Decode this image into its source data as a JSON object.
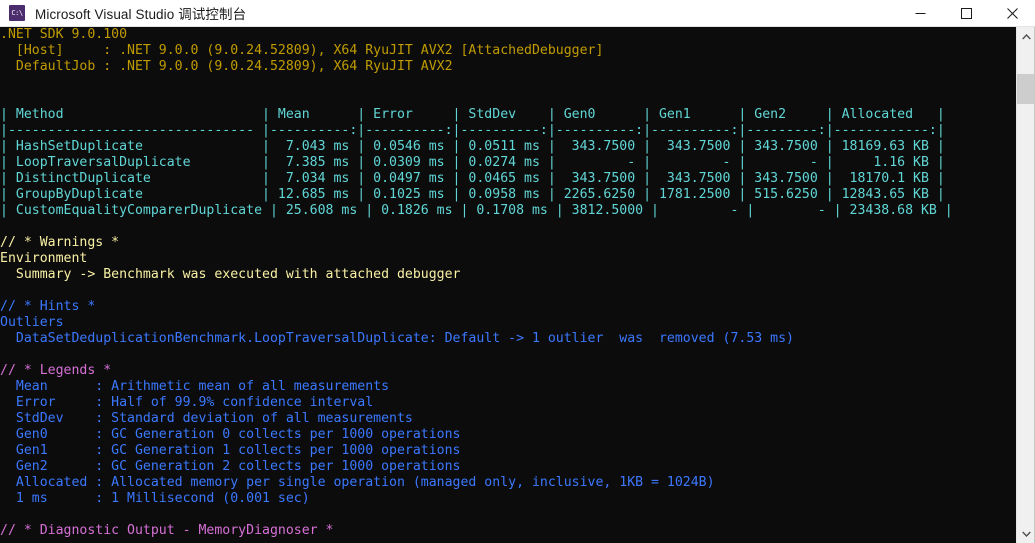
{
  "window": {
    "title": "Microsoft Visual Studio 调试控制台",
    "icon_name": "console-app-icon",
    "icon_glyph": "C:\\",
    "minimize_label": "Minimize",
    "maximize_label": "Maximize",
    "close_label": "Close"
  },
  "scrollbar": {
    "up_arrow_label": "Scroll up",
    "down_arrow_label": "Scroll down",
    "thumb_label": "Scroll thumb"
  },
  "colors": {
    "background": "#0c0c0c",
    "titlebar_background": "#ffffff",
    "titlebar_text": "#1b1b1b",
    "yellow": "#c19c00",
    "bright_yellow": "#f9f1a5",
    "bright_cyan": "#61d6d6",
    "bright_blue": "#3b78ff",
    "bright_magenta": "#d670d6",
    "accent_icon": "#4b2d6e"
  },
  "console": {
    "env_block": [
      ".NET SDK 9.0.100",
      "  [Host]     : .NET 9.0.0 (9.0.24.52809), X64 RyuJIT AVX2 [AttachedDebugger]",
      "  DefaultJob : .NET 9.0.0 (9.0.24.52809), X64 RyuJIT AVX2"
    ],
    "blank_1": "",
    "blank_2": "",
    "table": {
      "header_row": "| Method                         | Mean      | Error     | StdDev    | Gen0      | Gen1      | Gen2     | Allocated   |",
      "separator_row": "|------------------------------- |----------:|----------:|----------:|----------:|----------:|---------:|------------:|",
      "columns": [
        "Method",
        "Mean",
        "Error",
        "StdDev",
        "Gen0",
        "Gen1",
        "Gen2",
        "Allocated"
      ],
      "rows": [
        {
          "raw": "| HashSetDuplicate               |  7.043 ms | 0.0546 ms | 0.0511 ms |  343.7500 |  343.7500 | 343.7500 | 18169.63 KB |",
          "Method": "HashSetDuplicate",
          "Mean": "7.043 ms",
          "Error": "0.0546 ms",
          "StdDev": "0.0511 ms",
          "Gen0": "343.7500",
          "Gen1": "343.7500",
          "Gen2": "343.7500",
          "Allocated": "18169.63 KB"
        },
        {
          "raw": "| LoopTraversalDuplicate         |  7.385 ms | 0.0309 ms | 0.0274 ms |         - |         - |        - |     1.16 KB |",
          "Method": "LoopTraversalDuplicate",
          "Mean": "7.385 ms",
          "Error": "0.0309 ms",
          "StdDev": "0.0274 ms",
          "Gen0": "-",
          "Gen1": "-",
          "Gen2": "-",
          "Allocated": "1.16 KB"
        },
        {
          "raw": "| DistinctDuplicate              |  7.034 ms | 0.0497 ms | 0.0465 ms |  343.7500 |  343.7500 | 343.7500 |  18170.1 KB |",
          "Method": "DistinctDuplicate",
          "Mean": "7.034 ms",
          "Error": "0.0497 ms",
          "StdDev": "0.0465 ms",
          "Gen0": "343.7500",
          "Gen1": "343.7500",
          "Gen2": "343.7500",
          "Allocated": "18170.1 KB"
        },
        {
          "raw": "| GroupByDuplicate               | 12.685 ms | 0.1025 ms | 0.0958 ms | 2265.6250 | 1781.2500 | 515.6250 | 12843.65 KB |",
          "Method": "GroupByDuplicate",
          "Mean": "12.685 ms",
          "Error": "0.1025 ms",
          "StdDev": "0.0958 ms",
          "Gen0": "2265.6250",
          "Gen1": "1781.2500",
          "Gen2": "515.6250",
          "Allocated": "12843.65 KB"
        },
        {
          "raw": "| CustomEqualityComparerDuplicate | 25.608 ms | 0.1826 ms | 0.1708 ms | 3812.5000 |         - |        - | 23438.68 KB |",
          "Method": "CustomEqualityComparerDuplicate",
          "Mean": "25.608 ms",
          "Error": "0.1826 ms",
          "StdDev": "0.1708 ms",
          "Gen0": "3812.5000",
          "Gen1": "-",
          "Gen2": "-",
          "Allocated": "23438.68 KB"
        }
      ]
    },
    "warnings": {
      "header": "// * Warnings *",
      "group": "Environment",
      "lines": [
        "  Summary -> Benchmark was executed with attached debugger"
      ]
    },
    "hints": {
      "header": "// * Hints *",
      "group": "Outliers",
      "lines": [
        "  DataSetDeduplicationBenchmark.LoopTraversalDuplicate: Default -> 1 outlier  was  removed (7.53 ms)"
      ]
    },
    "legends": {
      "header": "// * Legends *",
      "entries": [
        "  Mean      : Arithmetic mean of all measurements",
        "  Error     : Half of 99.9% confidence interval",
        "  StdDev    : Standard deviation of all measurements",
        "  Gen0      : GC Generation 0 collects per 1000 operations",
        "  Gen1      : GC Generation 1 collects per 1000 operations",
        "  Gen2      : GC Generation 2 collects per 1000 operations",
        "  Allocated : Allocated memory per single operation (managed only, inclusive, 1KB = 1024B)",
        "  1 ms      : 1 Millisecond (0.001 sec)"
      ]
    },
    "diagnostic": {
      "header": "// * Diagnostic Output - MemoryDiagnoser *"
    }
  }
}
